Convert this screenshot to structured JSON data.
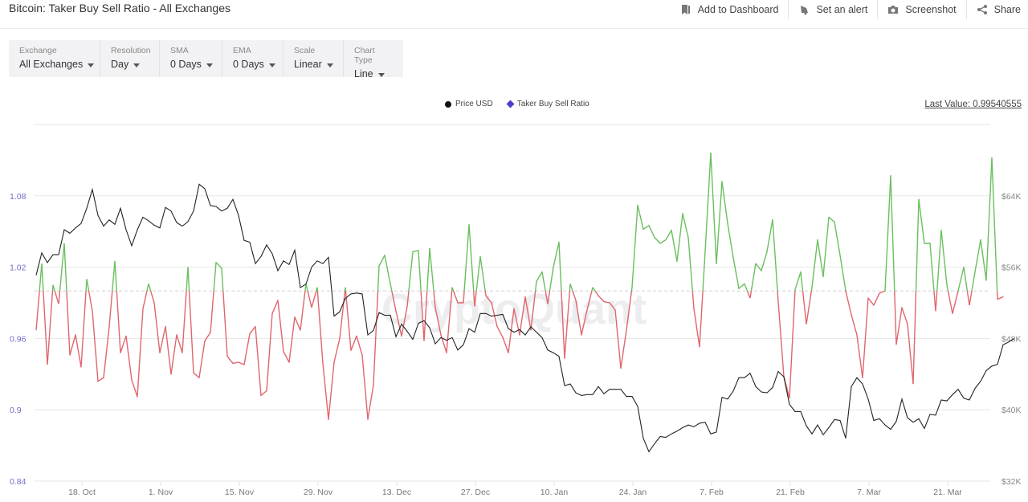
{
  "header": {
    "title": "Bitcoin: Taker Buy Sell Ratio - All Exchanges",
    "actions": [
      {
        "label": "Add to Dashboard",
        "icon": "bookmark-icon"
      },
      {
        "label": "Set an alert",
        "icon": "bell-icon"
      },
      {
        "label": "Screenshot",
        "icon": "camera-icon"
      },
      {
        "label": "Share",
        "icon": "share-icon"
      }
    ]
  },
  "controls": [
    {
      "label": "Exchange",
      "value": "All Exchanges"
    },
    {
      "label": "Resolution",
      "value": "Day"
    },
    {
      "label": "SMA",
      "value": "0 Days"
    },
    {
      "label": "EMA",
      "value": "0 Days"
    },
    {
      "label": "Scale",
      "value": "Linear"
    },
    {
      "label": "Chart Type",
      "value": "Line"
    }
  ],
  "legend": {
    "price": "Price USD",
    "ratio": "Taker Buy Sell Ratio"
  },
  "last_value": "Last Value: 0.99540555",
  "watermark": "CryptoQuant",
  "colors": {
    "above": "#6abf5e",
    "below": "#e0666e",
    "price": "#222222",
    "ratio_legend": "#4b3fcf",
    "left_axis": "#6f6cc9"
  },
  "chart_data": {
    "type": "line",
    "title": "Bitcoin: Taker Buy Sell Ratio - All Exchanges",
    "xlabel": "",
    "x_ticks": [
      "18. Oct",
      "1. Nov",
      "15. Nov",
      "29. Nov",
      "13. Dec",
      "27. Dec",
      "10. Jan",
      "24. Jan",
      "7. Feb",
      "21. Feb",
      "7. Mar",
      "21. Mar"
    ],
    "x_tick_day_index": [
      8,
      22,
      36,
      50,
      64,
      78,
      92,
      106,
      120,
      134,
      148,
      162
    ],
    "left_axis": {
      "label": "Taker Buy Sell Ratio",
      "ticks": [
        0.84,
        0.9,
        0.96,
        1.02,
        1.08
      ],
      "range": [
        0.84,
        1.14
      ]
    },
    "right_axis": {
      "label": "Price USD",
      "ticks": [
        "$32K",
        "$40K",
        "$48K",
        "$56K",
        "$64K"
      ],
      "tick_values": [
        32000,
        40000,
        48000,
        56000,
        64000
      ],
      "range": [
        32000,
        72000
      ]
    },
    "threshold": 1.0,
    "grid": true,
    "legend_position": "top-center",
    "start_date": "10. Oct",
    "series": [
      {
        "name": "Taker Buy Sell Ratio",
        "axis": "left",
        "values": [
          0.967,
          1.023,
          0.938,
          1.005,
          0.989,
          1.04,
          0.946,
          0.963,
          0.936,
          1.01,
          0.983,
          0.924,
          0.927,
          0.97,
          1.025,
          0.948,
          0.962,
          0.925,
          0.911,
          0.985,
          1.006,
          0.99,
          0.948,
          0.97,
          0.93,
          0.963,
          0.948,
          1.02,
          0.931,
          0.927,
          0.958,
          0.965,
          1.024,
          1.019,
          0.945,
          0.939,
          0.94,
          0.938,
          0.964,
          0.97,
          0.912,
          0.916,
          0.981,
          0.992,
          0.949,
          0.94,
          0.978,
          0.967,
          1.006,
          0.986,
          1.003,
          0.939,
          0.892,
          0.94,
          0.96,
          1.003,
          0.95,
          0.962,
          0.946,
          0.892,
          0.921,
          1.021,
          1.03,
          1.006,
          0.983,
          0.962,
          0.987,
          1.033,
          1.034,
          0.958,
          1.036,
          0.986,
          0.963,
          0.948,
          1.003,
          0.99,
          0.99,
          1.056,
          0.987,
          1.029,
          0.996,
          0.99,
          0.97,
          0.961,
          0.948,
          0.985,
          0.963,
          0.995,
          0.967,
          1.008,
          1.016,
          0.989,
          1.02,
          1.041,
          0.943,
          1.006,
          0.992,
          0.963,
          0.984,
          1.003,
          0.996,
          0.991,
          0.99,
          0.984,
          0.935,
          0.967,
          1.003,
          1.072,
          1.052,
          1.055,
          1.045,
          1.04,
          1.043,
          1.051,
          1.025,
          1.065,
          1.045,
          0.985,
          0.953,
          1.033,
          1.116,
          1.023,
          1.092,
          1.057,
          1.028,
          1.002,
          1.006,
          0.994,
          1.023,
          1.017,
          1.033,
          1.06,
          0.991,
          0.928,
          0.91,
          1.001,
          1.016,
          0.972,
          1.003,
          1.043,
          1.012,
          1.062,
          1.058,
          1.03,
          1.0,
          0.98,
          0.963,
          0.927,
          0.994,
          0.988,
          0.998,
          1.0,
          1.097,
          0.955,
          0.986,
          0.972,
          0.922,
          1.077,
          1.04,
          1.04,
          0.983,
          1.051,
          1.005,
          0.981,
          1.0,
          1.02,
          0.988,
          1.016,
          1.043,
          1.009,
          1.112,
          0.993,
          0.995
        ],
        "colors": {
          "above_threshold": "#6abf5e",
          "below_threshold": "#e0666e"
        }
      },
      {
        "name": "Price USD",
        "axis": "right",
        "values": [
          55100,
          57600,
          56500,
          57400,
          57400,
          60200,
          59800,
          60400,
          60900,
          62600,
          64700,
          61800,
          60600,
          61300,
          60800,
          62600,
          60200,
          58400,
          60200,
          61600,
          61200,
          60700,
          60400,
          62700,
          62300,
          61000,
          60600,
          61100,
          62300,
          65300,
          64800,
          62900,
          62800,
          62300,
          62600,
          63600,
          61800,
          59000,
          58800,
          56400,
          57200,
          58500,
          57500,
          55600,
          56700,
          56300,
          57900,
          53700,
          54100,
          56000,
          56700,
          56400,
          57100,
          50500,
          51000,
          52500,
          53000,
          53100,
          53000,
          48400,
          48900,
          50900,
          50600,
          50600,
          48200,
          49600,
          48800,
          47900,
          49700,
          50000,
          49200,
          47400,
          48100,
          47800,
          48100,
          46700,
          47300,
          49100,
          48700,
          50800,
          50800,
          50500,
          50600,
          50700,
          49100,
          48700,
          49000,
          48400,
          49300,
          48700,
          48100,
          46700,
          46400,
          46000,
          42700,
          42900,
          41900,
          41600,
          41700,
          41700,
          42600,
          41800,
          42300,
          42300,
          42300,
          41500,
          41500,
          40400,
          36800,
          35300,
          36200,
          37000,
          36900,
          37300,
          37600,
          38000,
          38300,
          38100,
          38500,
          38600,
          37300,
          37500,
          41400,
          41200,
          42100,
          43600,
          43600,
          44100,
          42600,
          42000,
          41900,
          42500,
          44300,
          43700,
          40600,
          39800,
          39800,
          38200,
          37300,
          38300,
          37200,
          38000,
          38900,
          38800,
          36800,
          42600,
          43600,
          42900,
          41200,
          38800,
          39000,
          38300,
          37800,
          38700,
          41200,
          39100,
          38600,
          39000,
          37900,
          39500,
          39400,
          41100,
          41000,
          41700,
          42300,
          41300,
          41100,
          42400,
          43200,
          44400,
          44900,
          45100,
          47300,
          47600,
          48000
        ]
      }
    ]
  }
}
